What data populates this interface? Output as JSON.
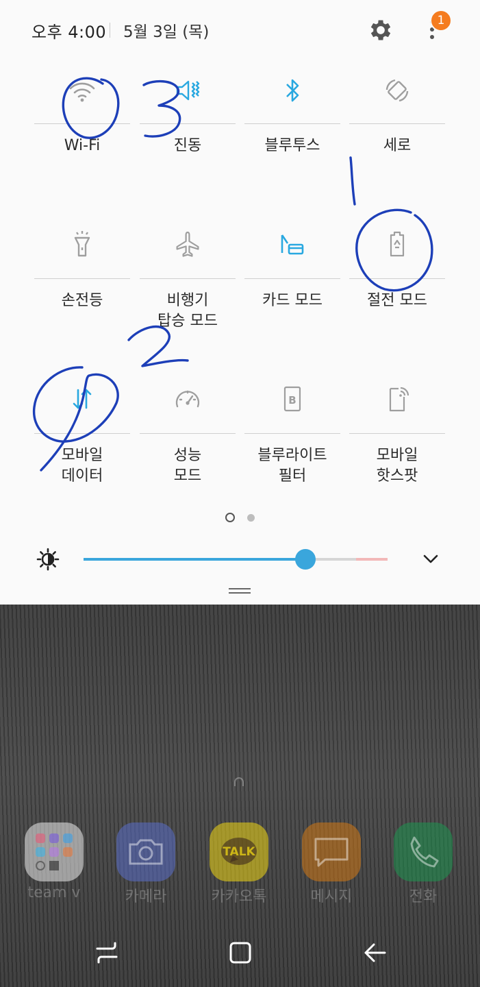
{
  "status_bar": {
    "time": "오후 4:00",
    "date": "5월 3일 (목)",
    "notification_count": "1"
  },
  "quick_tiles": [
    {
      "label": "Wi-Fi",
      "icon": "wifi-icon",
      "state": "off"
    },
    {
      "label": "진동",
      "icon": "vibrate-icon",
      "state": "on"
    },
    {
      "label": "블루투스",
      "icon": "bluetooth-icon",
      "state": "on"
    },
    {
      "label": "세로",
      "icon": "rotation-lock-icon",
      "state": "off"
    },
    {
      "label": "손전등",
      "icon": "flashlight-icon",
      "state": "off"
    },
    {
      "label": "비행기\n탑승 모드",
      "icon": "airplane-icon",
      "state": "off"
    },
    {
      "label": "카드 모드",
      "icon": "card-mode-icon",
      "state": "on"
    },
    {
      "label": "절전 모드",
      "icon": "power-saving-icon",
      "state": "off"
    },
    {
      "label": "모바일\n데이터",
      "icon": "mobile-data-icon",
      "state": "on"
    },
    {
      "label": "성능\n모드",
      "icon": "performance-icon",
      "state": "off"
    },
    {
      "label": "블루라이트\n필터",
      "icon": "blue-light-icon",
      "state": "off"
    },
    {
      "label": "모바일\n핫스팟",
      "icon": "hotspot-icon",
      "state": "off"
    }
  ],
  "pager": {
    "current": 1,
    "total": 2
  },
  "brightness": {
    "level": 0.73
  },
  "colors": {
    "accent": "#3aa6dc",
    "inactive_icon": "#9e9e9e",
    "badge": "#f57c1f",
    "annotation_ink": "#1d3fb8"
  },
  "dock": [
    {
      "label": "team v",
      "icon": "folder-icon"
    },
    {
      "label": "카메라",
      "icon": "camera-icon"
    },
    {
      "label": "카카오톡",
      "icon": "kakaotalk-icon",
      "badge_text": "TALK"
    },
    {
      "label": "메시지",
      "icon": "message-icon"
    },
    {
      "label": "전화",
      "icon": "phone-icon"
    }
  ],
  "handwritten_annotations": [
    "3",
    "1",
    "2"
  ]
}
